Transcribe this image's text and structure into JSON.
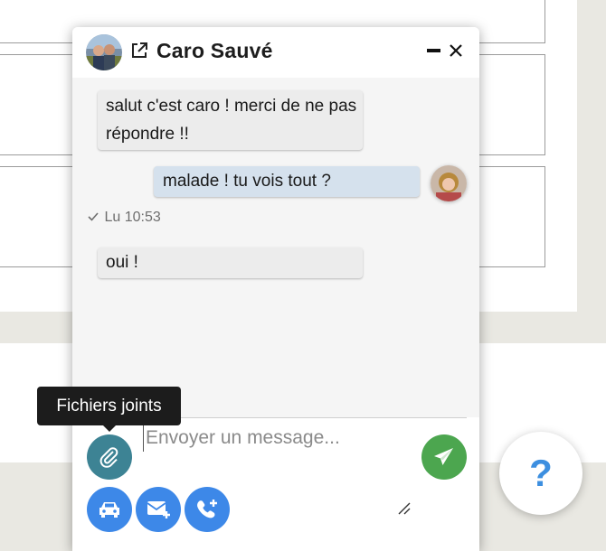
{
  "chat": {
    "contact_name": "Caro Sauvé",
    "messages": [
      {
        "direction": "in",
        "text": "salut c'est caro ! merci de ne pas répondre !!"
      },
      {
        "direction": "out",
        "text": "malade ! tu vois tout ?"
      },
      {
        "direction": "in",
        "text": "oui !"
      }
    ],
    "status": "Lu 10:53",
    "input_placeholder": "Envoyer un message...",
    "tooltip": "Fichiers joints",
    "icons": {
      "popout": "external-link-icon",
      "minimize": "minimize-icon",
      "close": "close-icon",
      "attach": "paperclip-icon",
      "send": "paper-plane-icon",
      "car": "car-icon",
      "mail": "mail-add-icon",
      "phone": "phone-add-icon",
      "resize": "resize-handle-icon"
    }
  },
  "help": {
    "label": "?"
  },
  "colors": {
    "attach": "#3d8394",
    "send": "#4ca64f",
    "action": "#3d88e8",
    "bubble_in": "#ececec",
    "bubble_out": "#d5e1ed",
    "help": "#3d8fe0"
  }
}
